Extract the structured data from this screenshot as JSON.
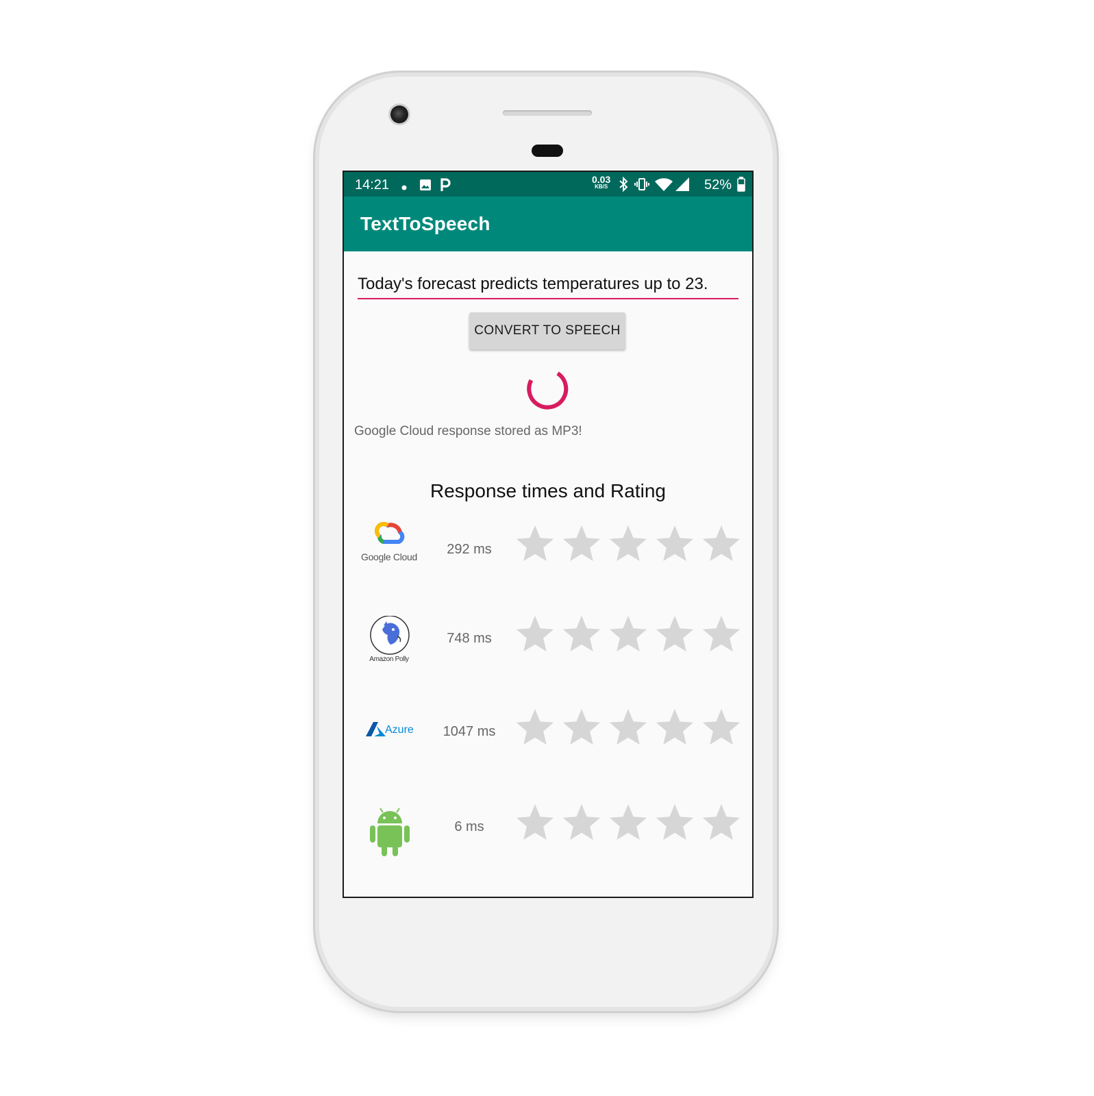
{
  "statusbar": {
    "time": "14:21",
    "net_speed": "0.03",
    "net_unit": "KB/S",
    "battery": "52%",
    "icons": [
      "dot-icon",
      "image-icon",
      "parking-icon",
      "bluetooth-icon",
      "vibrate-icon",
      "wifi-icon",
      "signal-icon",
      "battery-icon"
    ]
  },
  "app": {
    "title": "TextToSpeech"
  },
  "input": {
    "value": "Today's forecast predicts temperatures up to 23."
  },
  "button": {
    "label": "CONVERT TO SPEECH"
  },
  "status": {
    "message": "Google Cloud response stored as MP3!"
  },
  "section": {
    "title": "Response times and Rating"
  },
  "services": [
    {
      "name": "Google Cloud",
      "logo_text": "Google Cloud",
      "time": "292 ms",
      "rating": 0,
      "max_rating": 5
    },
    {
      "name": "Amazon Polly",
      "logo_text": "Amazon Polly",
      "time": "748 ms",
      "rating": 0,
      "max_rating": 5
    },
    {
      "name": "Azure",
      "logo_text": "Azure",
      "time": "1047 ms",
      "rating": 0,
      "max_rating": 5
    },
    {
      "name": "Android",
      "logo_text": "",
      "time": "6 ms",
      "rating": 0,
      "max_rating": 5
    }
  ],
  "colors": {
    "statusbar": "#00695c",
    "appbar": "#00897b",
    "accent": "#d81b60",
    "star_empty": "#d6d6d6",
    "android_green": "#78c257",
    "azure_blue": "#0089d6"
  }
}
